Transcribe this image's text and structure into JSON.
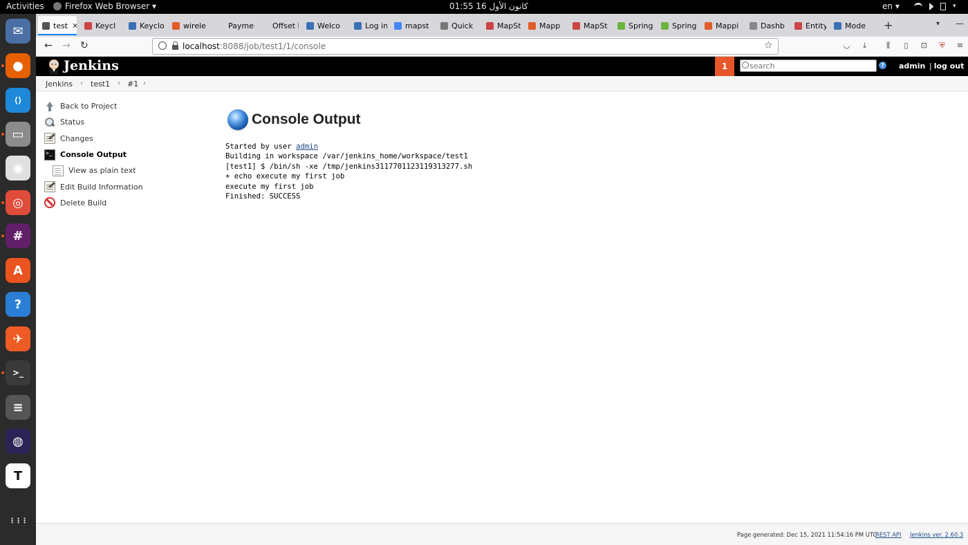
{
  "os_topbar": {
    "activities": "Activities",
    "app_name": "Firefox Web Browser",
    "clock": "كانون الأول 16  01:55",
    "language": "en"
  },
  "dock": {
    "apps": [
      {
        "name": "thunderbird",
        "glyph": "✉",
        "color": "#4a6fa5"
      },
      {
        "name": "firefox",
        "glyph": "●",
        "color": "#e66000"
      },
      {
        "name": "vscode",
        "glyph": "⟨⟩",
        "color": "#1e88d9"
      },
      {
        "name": "files",
        "glyph": "▭",
        "color": "#8c8c8c"
      },
      {
        "name": "rhythmbox",
        "glyph": "◉",
        "color": "#e0e0e0"
      },
      {
        "name": "chrome",
        "glyph": "◎",
        "color": "#e04b3a"
      },
      {
        "name": "slack",
        "glyph": "#",
        "color": "#611f69"
      },
      {
        "name": "software",
        "glyph": "A",
        "color": "#e95420"
      },
      {
        "name": "help",
        "glyph": "?",
        "color": "#2a7fd4"
      },
      {
        "name": "postman",
        "glyph": "✈",
        "color": "#ef5b25"
      },
      {
        "name": "terminal",
        "glyph": ">_",
        "color": "#3a3a3a"
      },
      {
        "name": "notes",
        "glyph": "≡",
        "color": "#555555"
      },
      {
        "name": "eclipse",
        "glyph": "◍",
        "color": "#2c2255"
      },
      {
        "name": "typora",
        "glyph": "T",
        "color": "#ffffff"
      },
      {
        "name": "show-apps",
        "glyph": "⋮⋮⋮",
        "color": "#2b2b2b"
      }
    ]
  },
  "browser": {
    "tabs": [
      {
        "label": "test",
        "active": true,
        "color": "#555"
      },
      {
        "label": "Keycl",
        "color": "#c44"
      },
      {
        "label": "Keyclo",
        "color": "#3b6fb6"
      },
      {
        "label": "wirele",
        "color": "#e05d2a"
      },
      {
        "label": "Payment",
        "color": "#d7d7db"
      },
      {
        "label": "Offset Ex",
        "color": "#d7d7db"
      },
      {
        "label": "Welco",
        "color": "#3b6fb6"
      },
      {
        "label": "Log in",
        "color": "#3b6fb6"
      },
      {
        "label": "mapst",
        "color": "#4285f4"
      },
      {
        "label": "Quick",
        "color": "#777"
      },
      {
        "label": "MapSt",
        "color": "#c44"
      },
      {
        "label": "Mapp",
        "color": "#e05d2a"
      },
      {
        "label": "MapSt",
        "color": "#c44"
      },
      {
        "label": "Spring",
        "color": "#6db33f"
      },
      {
        "label": "Spring",
        "color": "#6db33f"
      },
      {
        "label": "Mappi",
        "color": "#e05d2a"
      },
      {
        "label": "Dashb",
        "color": "#888"
      },
      {
        "label": "Entity",
        "color": "#c44"
      },
      {
        "label": "Mode",
        "color": "#3b6fb6"
      }
    ],
    "url_host": "localhost",
    "url_rest": ":8088/job/test1/1/console"
  },
  "jenkins": {
    "brand": "Jenkins",
    "notification_count": "1",
    "search_placeholder": "search",
    "user": "admin",
    "logout": "log out",
    "breadcrumbs": [
      "Jenkins",
      "test1",
      "#1"
    ],
    "side_tasks": [
      {
        "label": "Back to Project",
        "icon": "up-arrow-icon"
      },
      {
        "label": "Status",
        "icon": "magnifier-icon"
      },
      {
        "label": "Changes",
        "icon": "notepad-icon"
      },
      {
        "label": "Console Output",
        "icon": "terminal-icon",
        "current": true
      },
      {
        "label": "View as plain text",
        "icon": "document-icon",
        "sub": true
      },
      {
        "label": "Edit Build Information",
        "icon": "notepad-icon"
      },
      {
        "label": "Delete Build",
        "icon": "delete-icon"
      }
    ],
    "page_title": "Console Output",
    "console": {
      "line1_prefix": "Started by user ",
      "line1_user": "admin",
      "lines": [
        "Building in workspace /var/jenkins_home/workspace/test1",
        "[test1] $ /bin/sh -xe /tmp/jenkins3117701123119313277.sh",
        "+ echo execute my first job",
        "execute my first job",
        "Finished: SUCCESS"
      ]
    },
    "footer": {
      "generated": "Page generated: Dec 15, 2021 11:54:16 PM UTC",
      "rest_api": "REST API",
      "version": "Jenkins ver. 2.60.3"
    }
  }
}
